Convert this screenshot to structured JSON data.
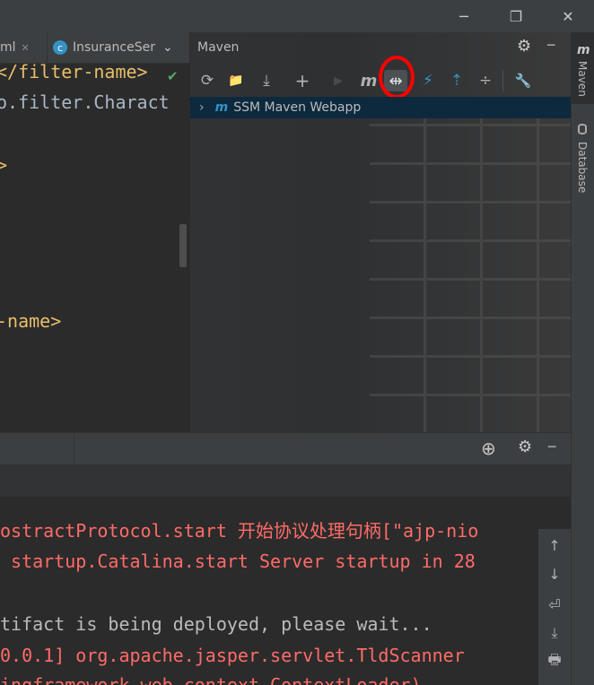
{
  "window": {
    "minimize": "─",
    "restore": "❐",
    "close": "✕"
  },
  "editor": {
    "tabs": [
      {
        "label": "ml",
        "close": "✕"
      },
      {
        "label": "InsuranceSer",
        "icon": "c",
        "dropdown": "⌄"
      }
    ],
    "code_lines": [
      "</filter-name>",
      "o.filter.Charact",
      ">",
      "-name>"
    ],
    "check": "✔"
  },
  "maven": {
    "title": "Maven",
    "gear": "⚙",
    "minimize": "─",
    "toolbar": {
      "reload": "⟳",
      "add_folder": "📁",
      "download": "⤓",
      "add": "+",
      "run": "▶",
      "execute_goal": "m",
      "toggle_offline": "⇹",
      "skip_tests": "⚡",
      "show_deps": "⇡",
      "collapse": "÷",
      "settings": "🔧"
    },
    "tree": {
      "expand": "›",
      "project_icon": "m",
      "project": "SSM Maven Webapp"
    }
  },
  "stripe": {
    "maven_icon": "m",
    "maven": "Maven",
    "database": "Database"
  },
  "bottom": {
    "target": "⊕",
    "gear": "⚙",
    "minimize": "─",
    "lines": [
      {
        "text": "ostractProtocol.start 开始协议处理句柄[\"ajp-nio",
        "color": "red"
      },
      {
        "text": " startup.Catalina.start Server startup in 28",
        "color": "red"
      },
      {
        "text": "",
        "color": "grey"
      },
      {
        "text": "tifact is being deployed, please wait...",
        "color": "grey"
      },
      {
        "text": "0.0.1] org.apache.jasper.servlet.TldScanner",
        "color": "red"
      },
      {
        "text": "ingframework.web.context.ContextLoader)",
        "color": "red"
      }
    ],
    "side_icons": [
      "↑",
      "↓",
      "⏎",
      "⤓",
      "🖶"
    ]
  }
}
